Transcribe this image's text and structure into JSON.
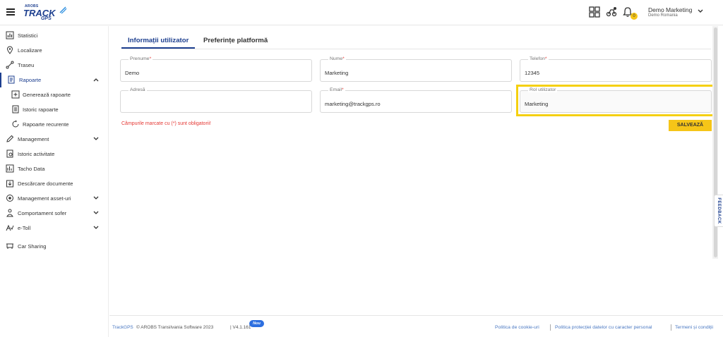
{
  "header": {
    "logo": {
      "brand_small": "AROBS",
      "brand_big": "TRACK",
      "brand_sub": "GPS"
    },
    "icons": [
      "apps-grid-icon",
      "vehicle-settings-icon",
      "bell-icon"
    ],
    "notification_count": "0",
    "user": {
      "name": "Demo Marketing",
      "company": "Demo Romania"
    }
  },
  "sidebar": {
    "items": [
      {
        "label": "Statistici",
        "icon": "bar-chart-icon"
      },
      {
        "label": "Localizare",
        "icon": "location-pin-icon"
      },
      {
        "label": "Traseu",
        "icon": "route-icon"
      },
      {
        "label": "Rapoarte",
        "icon": "report-icon",
        "expanded": true
      },
      {
        "label": "Generează rapoarte",
        "icon": "add-report-icon"
      },
      {
        "label": "Istoric rapoarte",
        "icon": "report-history-icon"
      },
      {
        "label": "Rapoarte recurente",
        "icon": "recurring-report-icon"
      },
      {
        "label": "Management",
        "icon": "pencil-icon"
      },
      {
        "label": "Istoric activitate",
        "icon": "activity-history-icon"
      },
      {
        "label": "Tacho Data",
        "icon": "tacho-icon"
      },
      {
        "label": "Descărcare documente",
        "icon": "download-icon"
      },
      {
        "label": "Management asset-uri",
        "icon": "asset-icon"
      },
      {
        "label": "Comportament sofer",
        "icon": "driver-icon"
      },
      {
        "label": "e-Toll",
        "icon": "toll-icon"
      },
      {
        "label": "Car Sharing",
        "icon": "car-sharing-icon"
      }
    ]
  },
  "tabs": [
    {
      "label": "Informații utilizator",
      "active": true
    },
    {
      "label": "Preferințe platformă",
      "active": false
    }
  ],
  "form": {
    "prenume": {
      "label": "Prenume",
      "required_mark": "*",
      "value": "Demo"
    },
    "nume": {
      "label": "Nume",
      "required_mark": "*",
      "value": "Marketing"
    },
    "telefon": {
      "label": "Telefon",
      "required_mark": "*",
      "value": "12345"
    },
    "adresa": {
      "label": "Adresă",
      "value": ""
    },
    "email": {
      "label": "Email",
      "required_mark": "*",
      "value": "marketing@trackgps.ro"
    },
    "rol": {
      "label": "Rol utilizator",
      "value": "Marketing"
    },
    "required_note": "Câmpurile marcate cu (*) sunt obligatorii!",
    "save_label": "SALVEAZĂ"
  },
  "feedback_label": "FEEDBACK",
  "footer": {
    "brand": "TrackGPS",
    "copyright": "© AROBS Transilvania Software 2023",
    "version": "| V4.1.161",
    "new_badge": "Nou",
    "links": [
      "Politica de cookie-uri",
      "Politica protecției datelor cu caracter personal",
      "Termeni și condiții"
    ]
  },
  "colors": {
    "brand_blue": "#1d3f8f",
    "accent_yellow": "#f5c518",
    "highlight_border": "#f5d010",
    "required_red": "#e53935",
    "link_blue": "#4a78c2"
  }
}
